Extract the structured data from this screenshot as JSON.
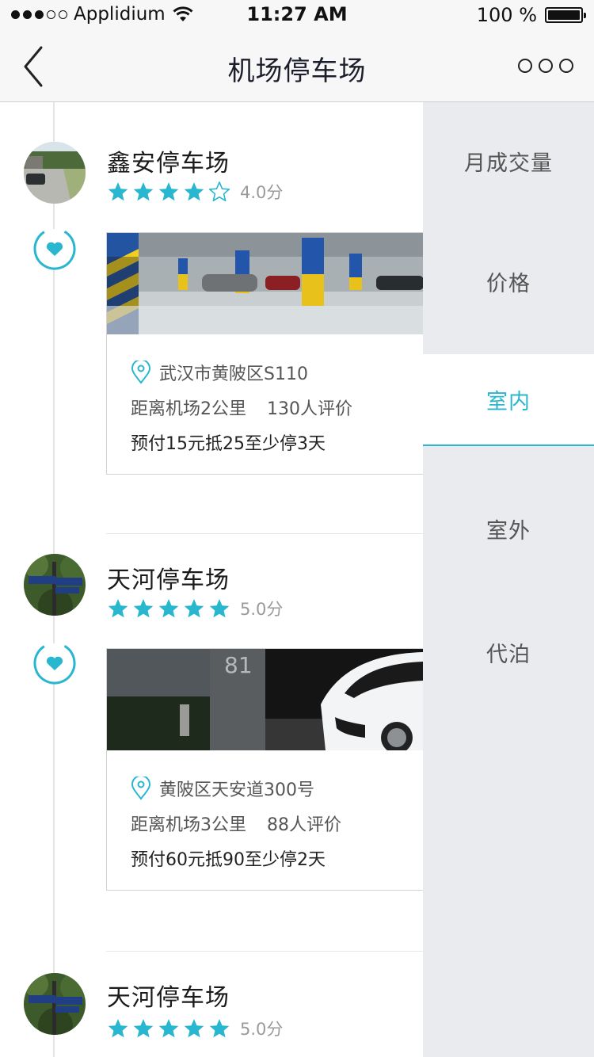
{
  "status_bar": {
    "carrier": "Applidium",
    "time": "11:27 AM",
    "battery": "100 %",
    "battery_level": 1.0
  },
  "nav": {
    "title": "机场停车场"
  },
  "colors": {
    "accent": "#29b6cf",
    "star_empty": "#29b6cf",
    "side_bg": "#e9ebee"
  },
  "lots": [
    {
      "name": "鑫安停车场",
      "rating": 4,
      "score": "4.0分",
      "address": "武汉市黄陂区S110",
      "distance": "距离机场2公里",
      "reviews": "130人评价",
      "promo": "预付15元抵25至少停3天",
      "photo": "indoor-garage"
    },
    {
      "name": "天河停车场",
      "rating": 5,
      "score": "5.0分",
      "address": "黄陂区天安道300号",
      "distance": "距离机场3公里",
      "reviews": "88人评价",
      "promo": "预付60元抵90至少停2天",
      "photo": "white-sports-car"
    },
    {
      "name": "天河停车场",
      "rating": 5,
      "score": "5.0分"
    }
  ],
  "side_filters": [
    {
      "label": "月成交量",
      "active": false
    },
    {
      "label": "价格",
      "active": false
    },
    {
      "label": "室内",
      "active": true
    },
    {
      "label": "室外",
      "active": false
    },
    {
      "label": "代泊",
      "active": false
    }
  ]
}
